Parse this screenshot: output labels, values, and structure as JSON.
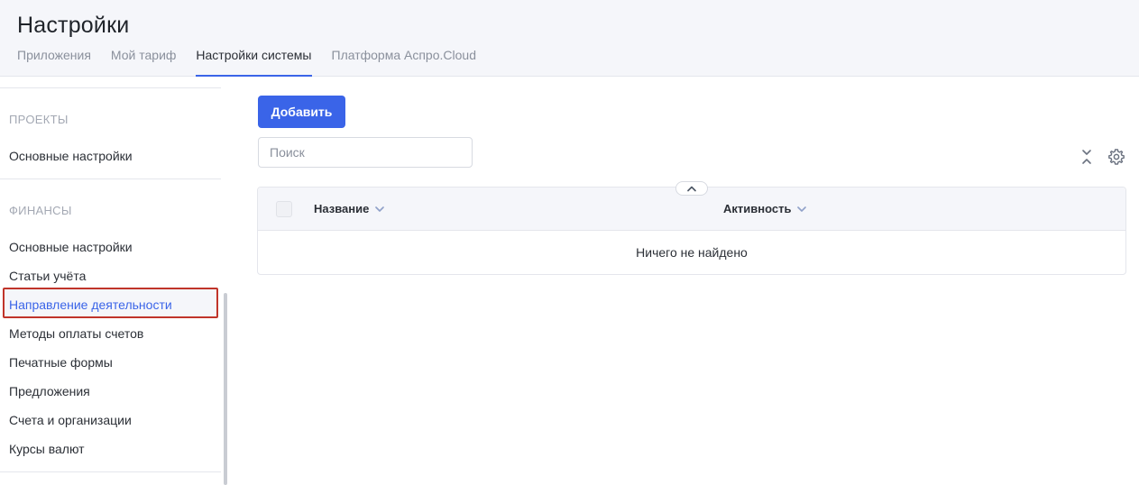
{
  "header": {
    "title": "Настройки",
    "tabs": [
      {
        "label": "Приложения"
      },
      {
        "label": "Мой тариф"
      },
      {
        "label": "Настройки системы"
      },
      {
        "label": "Платформа Аспро.Cloud"
      }
    ],
    "active_tab": "Настройки системы"
  },
  "sidebar": {
    "sections": [
      {
        "title": "ПРОЕКТЫ",
        "items": [
          "Основные настройки"
        ]
      },
      {
        "title": "ФИНАНСЫ",
        "items": [
          "Основные настройки",
          "Статьи учёта",
          "Направление деятельности",
          "Методы оплаты счетов",
          "Печатные формы",
          "Предложения",
          "Счета и организации",
          "Курсы валют"
        ]
      }
    ],
    "selected_item": "Направление деятельности"
  },
  "toolbar": {
    "add_label": "Добавить",
    "search_placeholder": "Поиск",
    "icons": [
      "expand-collapse-icon",
      "gear-icon"
    ]
  },
  "table": {
    "columns": [
      "Название",
      "Активность"
    ],
    "empty_text": "Ничего не найдено"
  },
  "colors": {
    "accent": "#3a64e8",
    "highlight_border": "#c0342a",
    "header_bg": "#f5f6fa"
  }
}
